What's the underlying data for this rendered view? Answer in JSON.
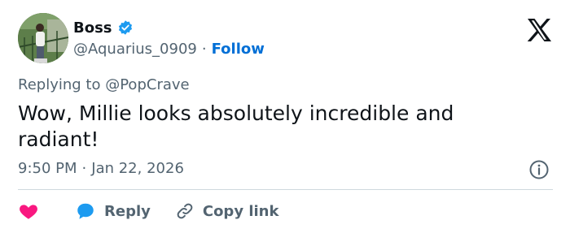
{
  "author": {
    "name": "Boss",
    "handle": "@Aquarius_0909",
    "separator": "·",
    "follow_label": "Follow",
    "verified": true
  },
  "reply_context": {
    "prefix": "Replying to",
    "mention": "@PopCrave"
  },
  "tweet": {
    "text": "Wow, Millie looks absolutely incredible and radiant!",
    "time": "9:50 PM",
    "separator": "·",
    "date": "Jan 22, 2026"
  },
  "actions": {
    "reply_label": "Reply",
    "copy_link_label": "Copy link"
  },
  "icons": {
    "logo": "x-logo-icon",
    "verified": "verified-badge-icon",
    "info": "info-icon",
    "like": "heart-icon",
    "reply": "speech-bubble-icon",
    "copy": "link-icon"
  },
  "colors": {
    "text": "#0f1419",
    "secondary": "#536471",
    "accent": "#1d9bf0",
    "follow": "#006fd6",
    "like": "#f91880",
    "divider": "#cfd9de"
  }
}
